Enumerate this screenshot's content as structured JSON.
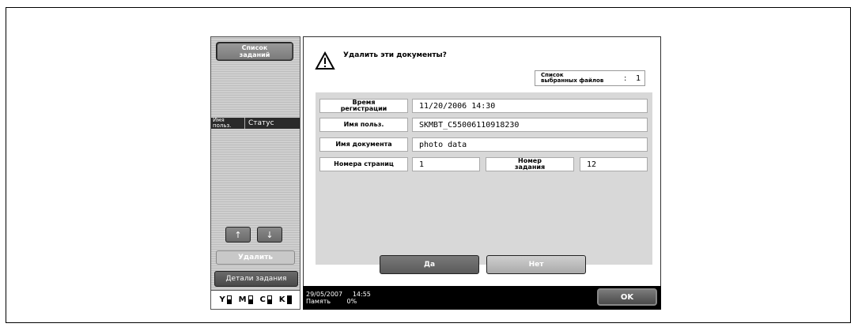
{
  "left_panel": {
    "job_list_line1": "Список",
    "job_list_line2": "заданий",
    "col_user_line1": "Имя",
    "col_user_line2": "польз.",
    "col_status": "Статус",
    "up_arrow": "↑",
    "down_arrow": "↓",
    "delete_label": "Удалить",
    "job_details_label": "Детали задания",
    "toner": [
      {
        "label": "Y",
        "level": 0.6
      },
      {
        "label": "M",
        "level": 0.6
      },
      {
        "label": "C",
        "level": 0.6
      },
      {
        "label": "K",
        "level": 1.0
      }
    ]
  },
  "dialog": {
    "message": "Удалить эти документы?",
    "selected_files_line1": "Список",
    "selected_files_line2": "выбранных файлов",
    "selected_colon": ":",
    "selected_count": "1",
    "reg_time_line1": "Время",
    "reg_time_line2": "регистрации",
    "reg_time_value": "11/20/2006  14:30",
    "user_name_label": "Имя польз.",
    "user_name_value": "SKMBT_C55006110918230",
    "doc_name_label": "Имя документа",
    "doc_name_value": "photo data",
    "pages_label": "Номера страниц",
    "pages_value": "1",
    "job_no_line1": "Номер",
    "job_no_line2": "задания",
    "job_no_value": "12",
    "yes_label": "Да",
    "no_label": "Нет"
  },
  "footer": {
    "date": "29/05/2007",
    "time": "14:55",
    "memory_label": "Память",
    "memory_value": "0%",
    "ok_label": "OK"
  },
  "icons": {
    "warning": "warning-triangle-icon"
  }
}
